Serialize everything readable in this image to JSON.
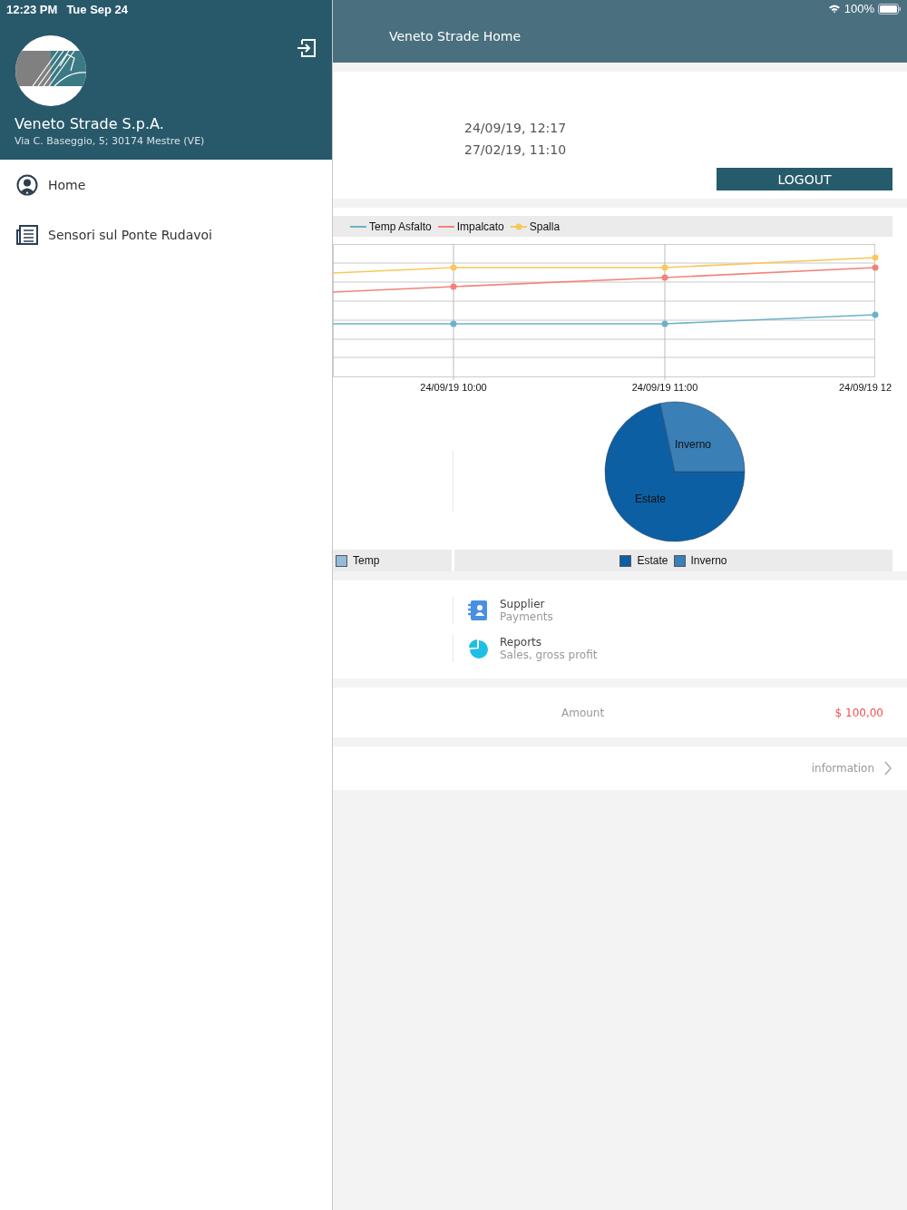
{
  "status_bar": {
    "time": "12:23 PM",
    "date": "Tue Sep 24",
    "battery": "100%"
  },
  "sidebar": {
    "company": "Veneto Strade S.p.A.",
    "address": "Via C. Baseggio, 5; 30174 Mestre (VE)",
    "items": [
      {
        "label": "Home",
        "kind": "home"
      },
      {
        "label": "Sensori sul Ponte Rudavoi",
        "kind": "list"
      }
    ]
  },
  "header": {
    "title": "Veneto Strade Home"
  },
  "session": {
    "dates": [
      "24/09/19, 12:17",
      "27/02/19, 11:10"
    ],
    "logout": "LOGOUT"
  },
  "line_chart": {
    "legend": [
      {
        "label": "Temp Asfalto",
        "color": "#6cb2c9"
      },
      {
        "label": "Impalcato",
        "color": "#f2837a"
      },
      {
        "label": "Spalla",
        "color": "#f7c85a"
      }
    ],
    "x_labels": [
      "24/09/19 10:00",
      "24/09/19 11:00",
      "24/09/19 12"
    ]
  },
  "pie_chart": {
    "slices": [
      {
        "label": "Estate",
        "color": "#0d5fa3"
      },
      {
        "label": "Inverno",
        "color": "#3a7fb5"
      }
    ],
    "side_legend": {
      "label": "Temp",
      "color": "#94bcd9"
    },
    "legend": [
      {
        "label": "Estate",
        "color": "#0d5fa3"
      },
      {
        "label": "Inverno",
        "color": "#3a7fb5"
      }
    ]
  },
  "menu": [
    {
      "title": "Supplier",
      "subtitle": "Payments",
      "kind": "contacts"
    },
    {
      "title": "Reports",
      "subtitle": "Sales, gross profit",
      "kind": "pie"
    }
  ],
  "amount": {
    "label": "Amount",
    "value": "$ 100,00"
  },
  "info": {
    "label": "information"
  }
}
